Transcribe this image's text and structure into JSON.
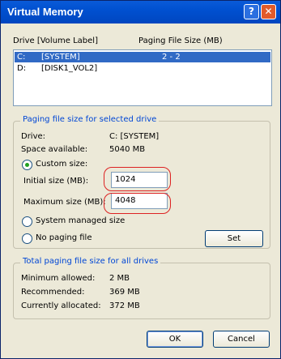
{
  "window": {
    "title": "Virtual Memory",
    "help_glyph": "?",
    "close_glyph": "✕"
  },
  "drives_header": {
    "drive": "Drive  [Volume Label]",
    "paging": "Paging File Size (MB)"
  },
  "drives": [
    {
      "drive": "C:",
      "label": "[SYSTEM]",
      "size": "2 - 2"
    },
    {
      "drive": "D:",
      "label": "[DISK1_VOL2]",
      "size": ""
    }
  ],
  "selected_group": {
    "title": "Paging file size for selected drive",
    "drive_label": "Drive:",
    "drive_value": "C:  [SYSTEM]",
    "space_label": "Space available:",
    "space_value": "5040 MB",
    "custom_size": "Custom size:",
    "initial_label": "Initial size (MB):",
    "initial_value": "1024",
    "maximum_label": "Maximum size (MB):",
    "maximum_value": "4048",
    "system_managed": "System managed size",
    "no_paging": "No paging file",
    "set_button": "Set"
  },
  "total_group": {
    "title": "Total paging file size for all drives",
    "min_label": "Minimum allowed:",
    "min_value": "2 MB",
    "rec_label": "Recommended:",
    "rec_value": "369 MB",
    "cur_label": "Currently allocated:",
    "cur_value": "372 MB"
  },
  "buttons": {
    "ok": "OK",
    "cancel": "Cancel"
  },
  "colors": {
    "title_bar": "#0050d0",
    "selection": "#316ac5",
    "group_title": "#0046d5",
    "annotation": "#dd2222"
  }
}
